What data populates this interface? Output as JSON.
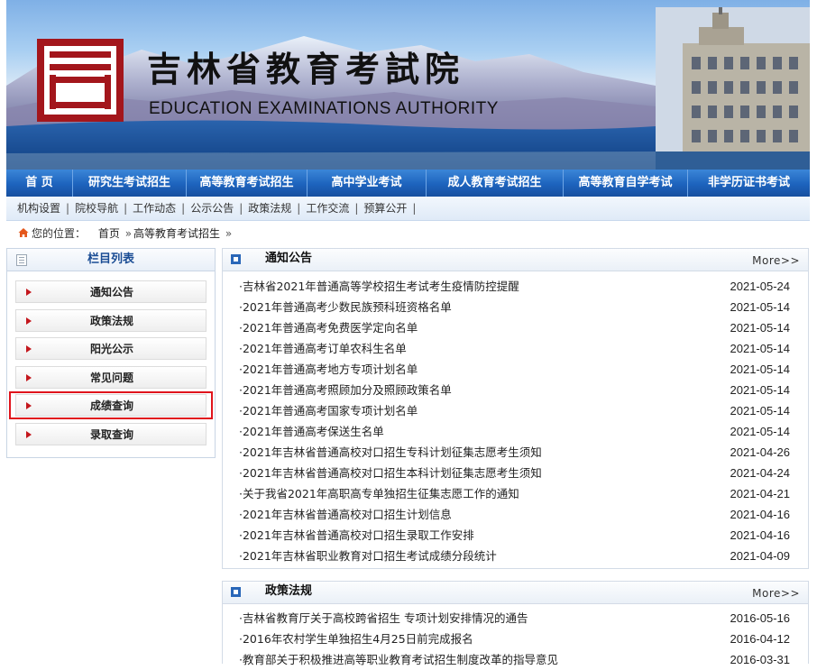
{
  "header": {
    "cn_title": "吉林省教育考試院",
    "en_title": "EDUCATION EXAMINATIONS AUTHORITY"
  },
  "main_nav": [
    {
      "label": "首 页"
    },
    {
      "label": "研究生考试招生"
    },
    {
      "label": "高等教育考试招生"
    },
    {
      "label": "高中学业考试"
    },
    {
      "label": "成人教育考试招生"
    },
    {
      "label": "高等教育自学考试"
    },
    {
      "label": "非学历证书考试"
    }
  ],
  "sub_nav": [
    {
      "label": "机构设置"
    },
    {
      "label": "院校导航"
    },
    {
      "label": "工作动态"
    },
    {
      "label": "公示公告"
    },
    {
      "label": "政策法规"
    },
    {
      "label": "工作交流"
    },
    {
      "label": "预算公开"
    }
  ],
  "sub_nav_sep": "|",
  "breadcrumb": {
    "prefix": "您的位置：",
    "home": "首页",
    "arrow": "»",
    "current": "高等教育考试招生",
    "trail": "»"
  },
  "sidebar": {
    "title": "栏目列表",
    "items": [
      {
        "label": "通知公告"
      },
      {
        "label": "政策法规"
      },
      {
        "label": "阳光公示"
      },
      {
        "label": "常见问题"
      },
      {
        "label": "成绩查询"
      },
      {
        "label": "录取查询"
      }
    ]
  },
  "notices": {
    "title": "通知公告",
    "more": "More>>",
    "items": [
      {
        "title": "·吉林省2021年普通高等学校招生考试考生疫情防控提醒",
        "date": "2021-05-24"
      },
      {
        "title": "·2021年普通高考少数民族预科班资格名单",
        "date": "2021-05-14"
      },
      {
        "title": "·2021年普通高考免费医学定向名单",
        "date": "2021-05-14"
      },
      {
        "title": "·2021年普通高考订单农科生名单",
        "date": "2021-05-14"
      },
      {
        "title": "·2021年普通高考地方专项计划名单",
        "date": "2021-05-14"
      },
      {
        "title": "·2021年普通高考照顾加分及照顾政策名单",
        "date": "2021-05-14"
      },
      {
        "title": "·2021年普通高考国家专项计划名单",
        "date": "2021-05-14"
      },
      {
        "title": "·2021年普通高考保送生名单",
        "date": "2021-05-14"
      },
      {
        "title": "·2021年吉林省普通高校对口招生专科计划征集志愿考生须知",
        "date": "2021-04-26"
      },
      {
        "title": "·2021年吉林省普通高校对口招生本科计划征集志愿考生须知",
        "date": "2021-04-24"
      },
      {
        "title": "·关于我省2021年高职高专单独招生征集志愿工作的通知",
        "date": "2021-04-21"
      },
      {
        "title": "·2021年吉林省普通高校对口招生计划信息",
        "date": "2021-04-16"
      },
      {
        "title": "·2021年吉林省普通高校对口招生录取工作安排",
        "date": "2021-04-16"
      },
      {
        "title": "·2021年吉林省职业教育对口招生考试成绩分段统计",
        "date": "2021-04-09"
      }
    ]
  },
  "policies": {
    "title": "政策法规",
    "more": "More>>",
    "items": [
      {
        "title": "·吉林省教育厅关于高校跨省招生 专项计划安排情况的通告",
        "date": "2016-05-16"
      },
      {
        "title": "·2016年农村学生单独招生4月25日前完成报名",
        "date": "2016-04-12"
      },
      {
        "title": "·教育部关于积极推进高等职业教育考试招生制度改革的指导意见",
        "date": "2016-03-31"
      }
    ]
  },
  "colors": {
    "nav_blue": "#1d63bd",
    "seal_red": "#a3161c",
    "highlight_red": "#e0141c",
    "sidebar_title": "#1a4c94"
  },
  "icons": {
    "home": "home-icon",
    "list": "list-icon",
    "panel": "square-icon",
    "bullet": "triangle-bullet-icon"
  }
}
